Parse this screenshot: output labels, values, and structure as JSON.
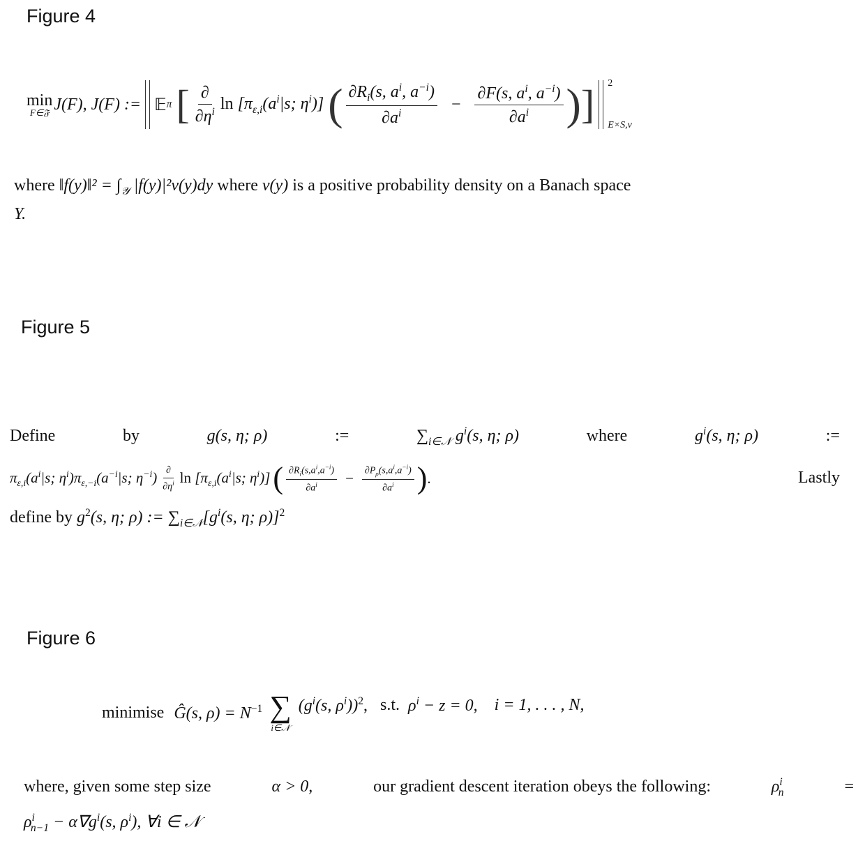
{
  "figures": [
    {
      "title": "Figure 4",
      "equation": {
        "lhs": "min J(F), J(F) :=",
        "min_subscript": "F∈𝔉",
        "expectation": "𝔼",
        "expectation_sub": "π",
        "partial_num": "∂",
        "partial_den": "∂η",
        "partial_den_sup": "i",
        "ln_term": "ln [π",
        "ln_sub": "ε,i",
        "ln_arg": "(a",
        "ln_arg_sup": "i",
        "ln_arg_rest": "|s; η",
        "ln_arg_rest_sup": "i",
        "ln_close": ")]",
        "frac1_num": "∂R",
        "frac1_num_sub": "i",
        "frac1_num_args": "(s, a",
        "frac1_num_sup1": "i",
        "frac1_num_mid": ", a",
        "frac1_num_sup2": "−i",
        "frac1_num_close": ")",
        "frac1_den": "∂a",
        "frac1_den_sup": "i",
        "minus": "−",
        "frac2_num": "∂F(s, a",
        "frac2_num_sup1": "i",
        "frac2_num_mid": ", a",
        "frac2_num_sup2": "−i",
        "frac2_num_close": ")",
        "frac2_den": "∂a",
        "frac2_den_sup": "i",
        "norm_sup": "2",
        "norm_sub": "E×S,ν"
      },
      "text": {
        "line1_where1": "where",
        "norm_def": "‖f(y)‖² = ∫",
        "norm_def_sub": "𝒴",
        "norm_def_rest": "|f(y)|²ν(y)dy",
        "line1_where2": "where",
        "nu_y": "ν(y)",
        "line1_rest": "is a positive probability density on a Banach space",
        "line2": "Y."
      }
    },
    {
      "title": "Figure 5",
      "text": {
        "l1_define": "Define",
        "l1_by": "by",
        "l1_g": "g(s, η; ρ)",
        "l1_assign1": ":=",
        "l1_sum": "∑",
        "l1_sum_sub": "i∈𝒩",
        "l1_gi": "g",
        "l1_gi_sup": "i",
        "l1_gi_args": "(s, η; ρ)",
        "l1_where": "where",
        "l1_gi2": "g",
        "l1_gi2_sup": "i",
        "l1_gi2_args": "(s, η; ρ)",
        "l1_assign2": ":=",
        "l2_pi1": "π",
        "l2_pi1_sub": "ε,i",
        "l2_pi1_args": "(a",
        "l2_pi1_sup": "i",
        "l2_pi1_rest": "|s; η",
        "l2_pi1_rest_sup": "i",
        "l2_pi1_close": ")",
        "l2_pi2": "π",
        "l2_pi2_sub": "ε,−i",
        "l2_pi2_args": "(a",
        "l2_pi2_sup": "−i",
        "l2_pi2_rest": "|s; η",
        "l2_pi2_rest_sup": "−i",
        "l2_pi2_close": ")",
        "l2_dnum": "∂",
        "l2_dden": "∂η",
        "l2_dden_sup": "i",
        "l2_ln": "ln [π",
        "l2_ln_sub": "ε,i",
        "l2_ln_args": "(a",
        "l2_ln_sup": "i",
        "l2_ln_rest": "|s; η",
        "l2_ln_rest_sup": "i",
        "l2_ln_close": ")]",
        "l2_f1_num": "∂R",
        "l2_f1_num_sub": "i",
        "l2_f1_num_args": "(s,a",
        "l2_f1_num_sup1": "i",
        "l2_f1_num_mid": ",a",
        "l2_f1_num_sup2": "−i",
        "l2_f1_num_close": ")",
        "l2_f1_den": "∂a",
        "l2_f1_den_sup": "i",
        "l2_minus": "−",
        "l2_f2_num": "∂P",
        "l2_f2_num_sub": "ρ",
        "l2_f2_num_args": "(s,a",
        "l2_f2_num_sup1": "i",
        "l2_f2_num_mid": ",a",
        "l2_f2_num_sup2": "−i",
        "l2_f2_num_close": ")",
        "l2_f2_den": "∂a",
        "l2_f2_den_sup": "i",
        "l2_period": ".",
        "l2_lastly": "Lastly",
        "l3_define": "define by",
        "l3_g2": "g",
        "l3_g2_sup": "2",
        "l3_g2_args": "(s, η; ρ) :=",
        "l3_sum": "∑",
        "l3_sum_sub": "i∈𝒩",
        "l3_bracket": "[g",
        "l3_bracket_sup": "i",
        "l3_bracket_args": "(s, η; ρ)]",
        "l3_bracket_pow": "2"
      }
    },
    {
      "title": "Figure 6",
      "equation": {
        "minimise": "minimise",
        "G": "Ĝ(s, ρ) = N",
        "G_sup": "−1",
        "sum": "∑",
        "sum_sub": "i∈𝒩",
        "term": "(g",
        "term_sup": "i",
        "term_args": "(s, ρ",
        "term_args_sup": "i",
        "term_close": "))",
        "term_pow": "2",
        "comma": ",",
        "st": "s.t.",
        "constraint": "ρ",
        "constraint_sup": "i",
        "constraint_rest": "− z = 0,",
        "index": "i = 1, . . . , N,"
      },
      "text": {
        "line1": "where, given some step size",
        "alpha_gt": "α > 0,",
        "line1_rest": "our gradient descent iteration obeys the following:",
        "rho_n": "ρ",
        "rho_n_sup": "i",
        "rho_n_sub": "n",
        "assign": "=",
        "line2_rho": "ρ",
        "line2_rho_sup": "i",
        "line2_rho_sub": "n−1",
        "line2_rest": "− α∇g",
        "line2_g_sup": "i",
        "line2_args": "(s, ρ",
        "line2_args_sup": "i",
        "line2_close": "), ∀i ∈ 𝒩"
      }
    }
  ]
}
